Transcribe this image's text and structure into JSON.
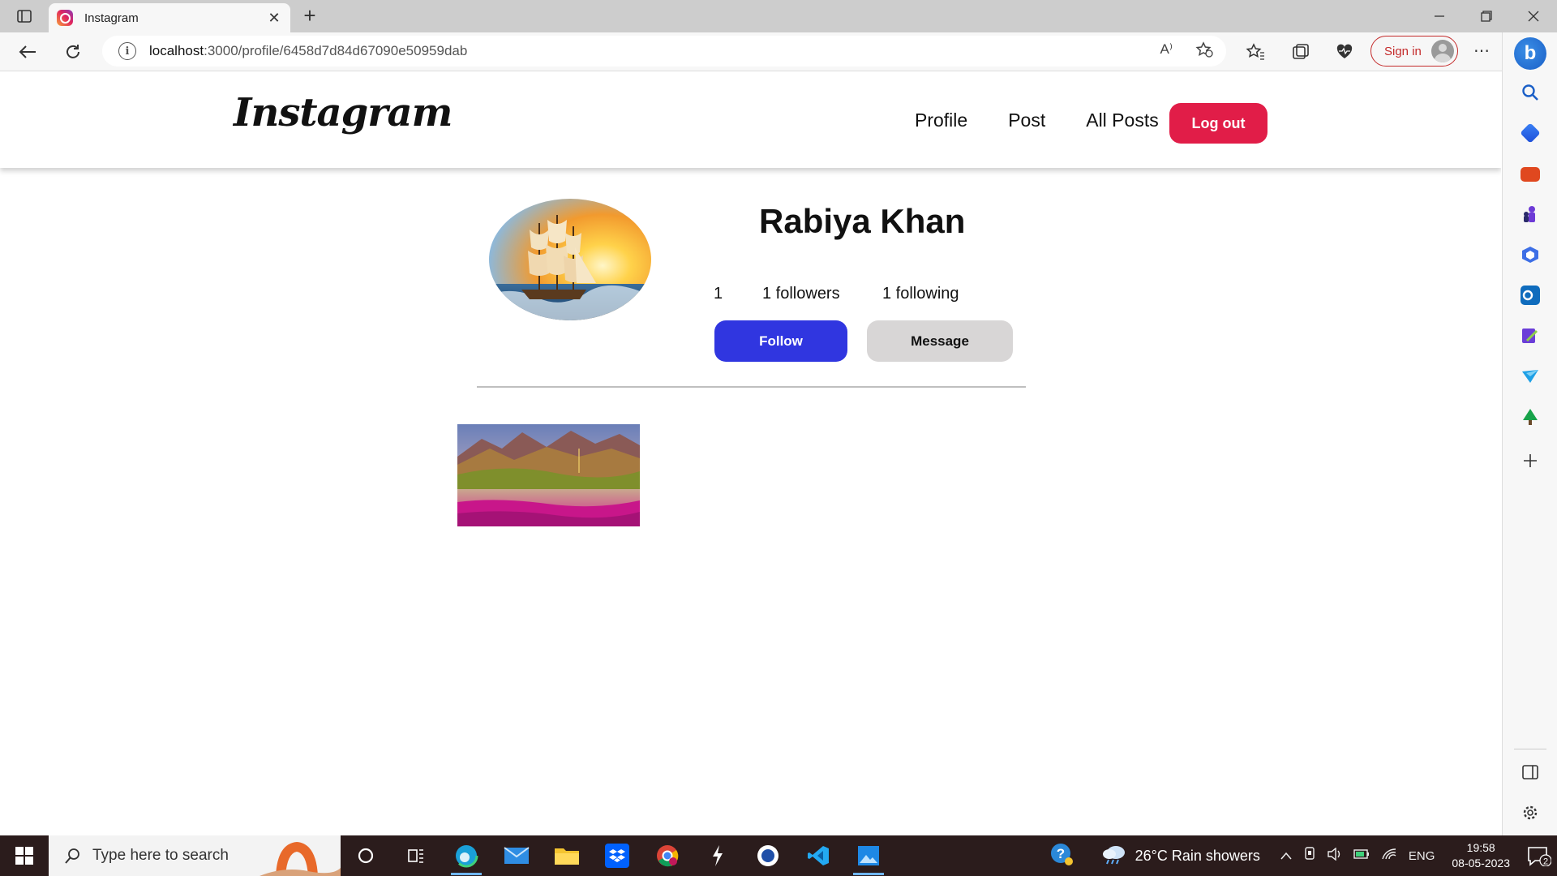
{
  "browser": {
    "tab_title": "Instagram",
    "tab_close": "✕",
    "new_tab": "+",
    "url_host": "localhost",
    "url_path": ":3000/profile/6458d7d84d67090e50959dab",
    "read_aloud": "A⁾",
    "sign_in": "Sign in",
    "more": "⋯"
  },
  "app": {
    "logo": "Instagram",
    "nav": [
      "Profile",
      "Post",
      "All Posts"
    ],
    "logout_label": "Log out"
  },
  "profile": {
    "name": "Rabiya Khan",
    "posts_count": "1",
    "followers": "1 followers",
    "following": "1 following",
    "follow_label": "Follow",
    "message_label": "Message"
  },
  "taskbar": {
    "search_placeholder": "Type here to search",
    "weather": "26°C  Rain showers",
    "language": "ENG",
    "time": "19:58",
    "date": "08-05-2023",
    "notification_count": "2"
  },
  "colors": {
    "logout": "#e11d48",
    "follow": "#3036e0",
    "message": "#d8d6d6"
  }
}
